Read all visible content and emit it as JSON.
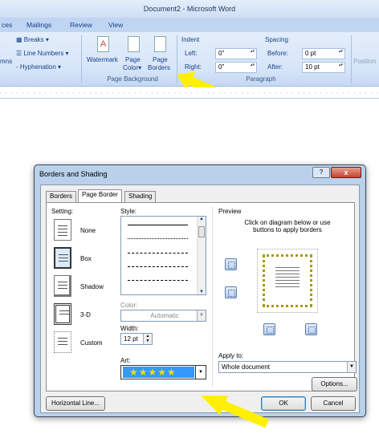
{
  "window_title": "Document2 - Microsoft Word",
  "ribbon_tabs": [
    "ces",
    "Mailings",
    "Review",
    "View"
  ],
  "page_setup": {
    "breaks": "Breaks",
    "line_numbers": "Line Numbers",
    "hyphenation": "Hyphenation",
    "columns": "mns"
  },
  "page_background": {
    "watermark": "Watermark",
    "page_color_1": "Page",
    "page_color_2": "Color",
    "page_borders_1": "Page",
    "page_borders_2": "Borders",
    "group_label": "Page Background"
  },
  "paragraph": {
    "indent": "Indent",
    "left_label": "Left:",
    "left_value": "0\"",
    "right_label": "Right:",
    "right_value": "0\"",
    "spacing": "Spacing",
    "before_label": "Before:",
    "before_value": "0 pt",
    "after_label": "After:",
    "after_value": "10 pt",
    "group_label": "Paragraph",
    "position": "Position"
  },
  "dialog": {
    "title": "Borders and Shading",
    "help": "?",
    "close": "x",
    "tabs": [
      "Borders",
      "Page Border",
      "Shading"
    ],
    "setting_label": "Setting:",
    "settings": [
      "None",
      "Box",
      "Shadow",
      "3-D",
      "Custom"
    ],
    "style_label": "Style:",
    "color_label": "Color:",
    "color_value": "Automatic",
    "width_label": "Width:",
    "width_value": "12 pt",
    "art_label": "Art:",
    "art_value": "★★★★★",
    "preview_label": "Preview",
    "preview_hint": "Click on diagram below or use buttons to apply borders",
    "apply_to_label": "Apply to:",
    "apply_to_value": "Whole document",
    "options_button": "Options...",
    "horizontal_line_button": "Horizontal Line...",
    "ok_button": "OK",
    "cancel_button": "Cancel"
  },
  "colors": {
    "arrow": "#ffef00",
    "ribbon": "#d6e5f8",
    "dialog_frame": "#b9d1ea"
  }
}
